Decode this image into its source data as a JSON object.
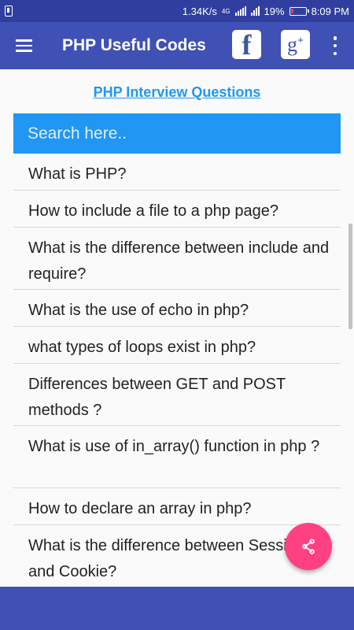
{
  "status_bar": {
    "speed": "1.34K/s",
    "network": "4G",
    "battery": "19%",
    "time": "8:09 PM"
  },
  "app_bar": {
    "title": "PHP Useful Codes",
    "facebook_glyph": "f",
    "gplus_glyph": "g",
    "gplus_sup": "+"
  },
  "content": {
    "link_text": "PHP Interview Questions",
    "search_placeholder": "Search here..",
    "questions": [
      "What is PHP?",
      "How to include a file to a php page?",
      "What is the difference between include and require?",
      "What is the use of echo in php?",
      "what types of loops exist in php?",
      "Differences between GET and POST methods ?",
      "What is use of in_array() function in php ?",
      "How to declare an array in php?",
      "What is the difference between Session and Cookie?"
    ]
  },
  "colors": {
    "primary": "#3f51b5",
    "primary_dark": "#303f9f",
    "accent": "#ff4081",
    "search_blue": "#2196f3"
  },
  "icons": {
    "menu": "hamburger-menu-icon",
    "facebook": "facebook-icon",
    "google_plus": "google-plus-icon",
    "more": "more-vert-icon",
    "share": "share-icon"
  }
}
